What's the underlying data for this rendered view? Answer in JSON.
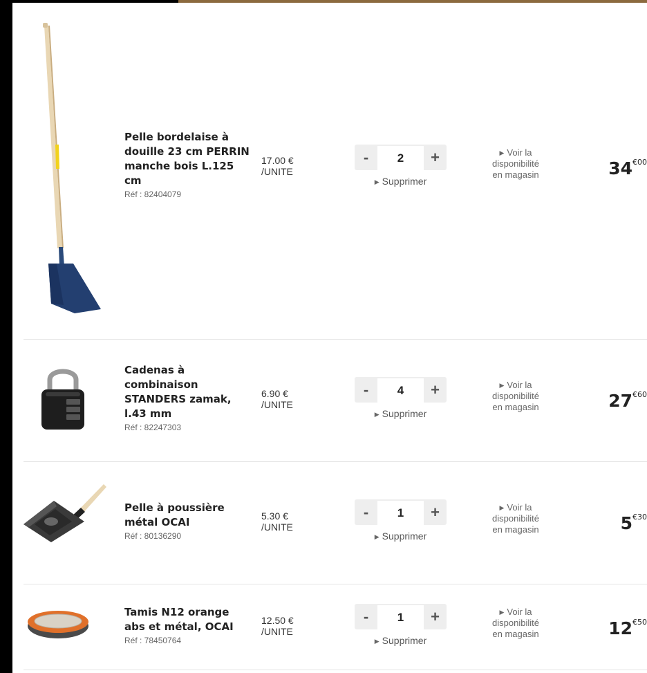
{
  "cart": {
    "items": [
      {
        "name": "Pelle bordelaise à douille 23 cm PERRIN manche bois L.125 cm",
        "ref": "Réf : 82404079",
        "unit_price": "17.00 €",
        "unit_label": "/UNITE",
        "quantity": "2",
        "remove_label": "Supprimer",
        "availability": [
          "Voir la",
          "disponibilité",
          "en magasin"
        ],
        "total_int": "34",
        "total_dec": "€00",
        "image": "shovel-image"
      },
      {
        "name": "Cadenas à combinaison STANDERS zamak, l.43 mm",
        "ref": "Réf : 82247303",
        "unit_price": "6.90 €",
        "unit_label": "/UNITE",
        "quantity": "4",
        "remove_label": "Supprimer",
        "availability": [
          "Voir la",
          "disponibilité",
          "en magasin"
        ],
        "total_int": "27",
        "total_dec": "€60",
        "image": "padlock-image"
      },
      {
        "name": "Pelle à poussière métal OCAI",
        "ref": "Réf : 80136290",
        "unit_price": "5.30 €",
        "unit_label": "/UNITE",
        "quantity": "1",
        "remove_label": "Supprimer",
        "availability": [
          "Voir la",
          "disponibilité",
          "en magasin"
        ],
        "total_int": "5",
        "total_dec": "€30",
        "image": "dustpan-image"
      },
      {
        "name": "Tamis N12 orange abs et métal, OCAI",
        "ref": "Réf : 78450764",
        "unit_price": "12.50 €",
        "unit_label": "/UNITE",
        "quantity": "1",
        "remove_label": "Supprimer",
        "availability": [
          "Voir la",
          "disponibilité",
          "en magasin"
        ],
        "total_int": "12",
        "total_dec": "€50",
        "image": "sieve-image"
      }
    ],
    "stepper": {
      "minus": "-",
      "plus": "+"
    },
    "colors": {
      "stepper_bg": "#eeeeee",
      "separator": "#e4e4e4",
      "frame": "#000000"
    }
  }
}
